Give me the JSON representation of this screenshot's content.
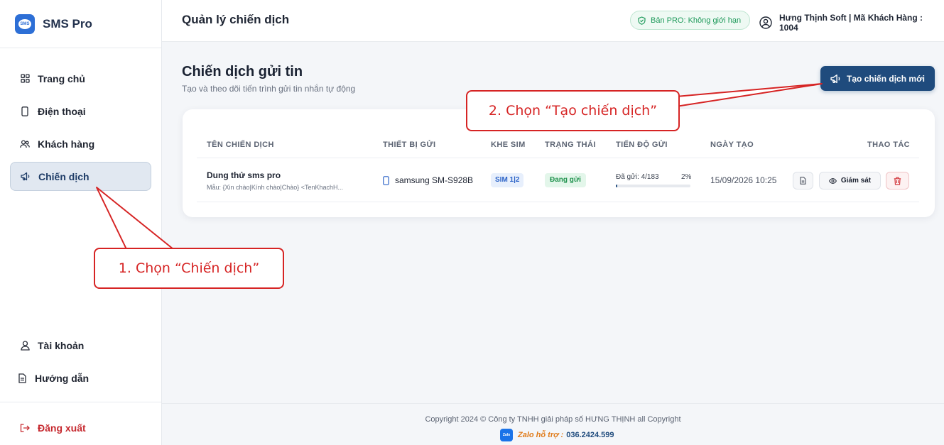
{
  "brand": {
    "name": "SMS Pro",
    "logo_text": "SMS"
  },
  "sidebar": {
    "items": [
      {
        "label": "Trang chủ",
        "icon": "grid-icon"
      },
      {
        "label": "Điện thoại",
        "icon": "phone-icon"
      },
      {
        "label": "Khách hàng",
        "icon": "users-icon"
      },
      {
        "label": "Chiến dịch",
        "icon": "megaphone-icon",
        "active": true
      }
    ],
    "bottom_items": [
      {
        "label": "Tài khoản",
        "icon": "user-icon"
      },
      {
        "label": "Hướng dẫn",
        "icon": "document-icon"
      }
    ],
    "logout": {
      "label": "Đăng xuất",
      "icon": "logout-icon"
    }
  },
  "header": {
    "title": "Quản lý chiến dịch",
    "pro_badge": "Bản PRO: Không giới hạn",
    "user": "Hưng Thịnh Soft | Mã Khách Hàng : 1004"
  },
  "main": {
    "title": "Chiến dịch gửi tin",
    "subtitle": "Tạo và theo dõi tiến trình gửi tin nhắn tự động",
    "create_button": "Tạo chiến dịch mới"
  },
  "table": {
    "headers": [
      "TÊN CHIẾN DỊCH",
      "THIẾT BỊ GỬI",
      "KHE SIM",
      "TRẠNG THÁI",
      "TIẾN ĐỘ GỬI",
      "NGÀY TẠO",
      "THAO TÁC"
    ],
    "rows": [
      {
        "name": "Dung thử sms pro",
        "template": "Mẫu: {Xin chào|Kính chào|Chào} <TenKhachH...",
        "device": "samsung SM-S928B",
        "sim": "SIM 1|2",
        "status": "Đang gửi",
        "progress_label": "Đã gửi: 4/183",
        "progress_pct": "2%",
        "progress_value": 0.02,
        "created": "15/09/2026 10:25",
        "watch_label": "Giám sát"
      }
    ]
  },
  "footer": {
    "copyright": "Copyright 2024 © Công ty TNHH giải pháp số HƯNG THỊNH all Copyright",
    "zalo_icon_text": "Zalo",
    "support_label": "Zalo hỗ trợ :",
    "support_number": "036.2424.599"
  },
  "callouts": {
    "step1": "1. Chọn “Chiến dịch”",
    "step2": "2. Chọn “Tạo chiến dịch”"
  },
  "colors": {
    "primary": "#1f4b7d",
    "danger": "#c6292f",
    "success": "#22934f",
    "callout": "#d62424"
  }
}
